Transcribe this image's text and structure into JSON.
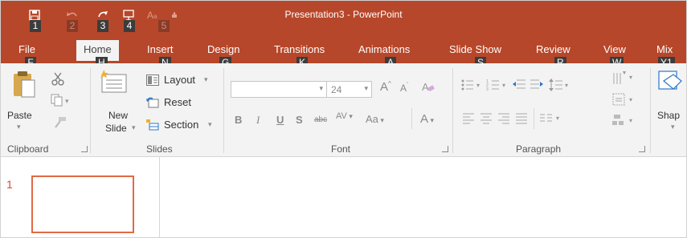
{
  "window": {
    "title": "Presentation3 - PowerPoint"
  },
  "qat_keytips": [
    "1",
    "2",
    "3",
    "4",
    "5"
  ],
  "tabs": [
    {
      "label": "File",
      "keytip": "F"
    },
    {
      "label": "Home",
      "keytip": "H"
    },
    {
      "label": "Insert",
      "keytip": "N"
    },
    {
      "label": "Design",
      "keytip": "G"
    },
    {
      "label": "Transitions",
      "keytip": "K"
    },
    {
      "label": "Animations",
      "keytip": "A"
    },
    {
      "label": "Slide Show",
      "keytip": "S"
    },
    {
      "label": "Review",
      "keytip": "R"
    },
    {
      "label": "View",
      "keytip": "W"
    },
    {
      "label": "Mix",
      "keytip": "Y1"
    }
  ],
  "ribbon": {
    "clipboard": {
      "paste": "Paste",
      "group": "Clipboard"
    },
    "slides": {
      "new_slide_1": "New",
      "new_slide_2": "Slide",
      "layout": "Layout",
      "reset": "Reset",
      "section": "Section",
      "group": "Slides"
    },
    "font": {
      "font_name": "",
      "font_size": "24",
      "bold": "B",
      "italic": "I",
      "underline": "U",
      "shadow": "S",
      "strike": "abc",
      "spacing": "AV",
      "change_case": "Aa",
      "color": "A",
      "grow": "A",
      "shrink": "A",
      "group": "Font"
    },
    "paragraph": {
      "group": "Paragraph"
    },
    "drawing": {
      "shapes": "Shap"
    }
  },
  "thumbnails": {
    "slide_number": "1"
  },
  "colors": {
    "accent": "#b7472a",
    "ribbon_bg": "#f3f3f3",
    "keytip_bg": "#3c3c3c",
    "thumb_border": "#e06a45"
  }
}
